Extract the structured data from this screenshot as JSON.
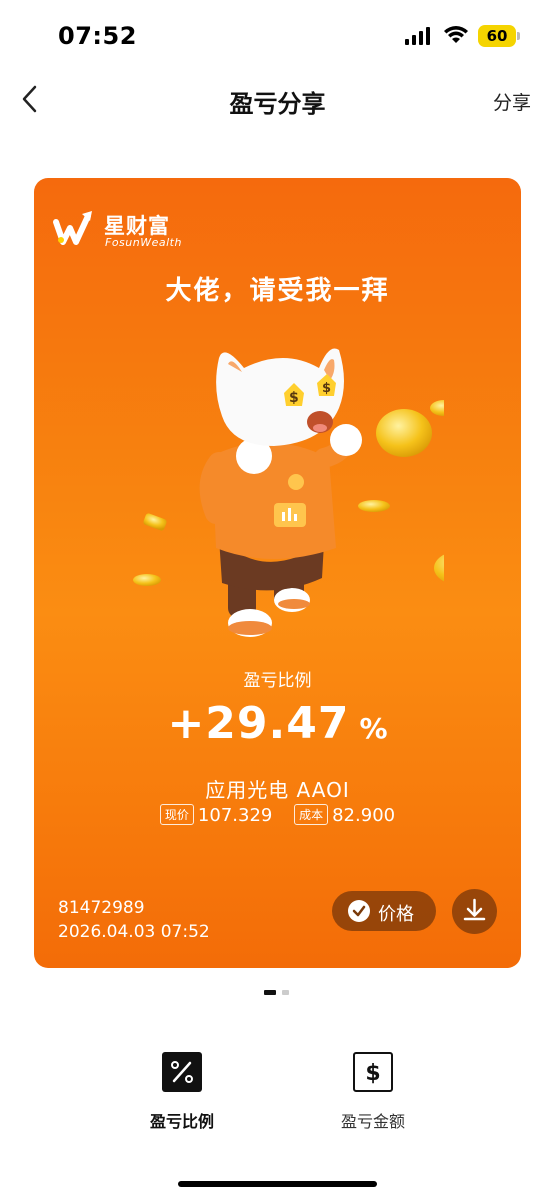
{
  "status_bar": {
    "time": "07:52",
    "battery": "60"
  },
  "nav": {
    "title": "盈亏分享",
    "share_label": "分享"
  },
  "card": {
    "logo_cn": "星财富",
    "logo_en": "FosunWealth",
    "slogan": "大佬，请受我一拜",
    "ratio_label": "盈亏比例",
    "ratio_value": "+29.47",
    "ratio_unit": "%",
    "stock_name": "应用光电 AAOI",
    "current_price_tag": "现价",
    "current_price": "107.329",
    "cost_tag": "成本",
    "cost": "82.900",
    "user_id": "81472989",
    "datetime": "2026.04.03 07:52",
    "price_button_label": "价格"
  },
  "pager": {
    "pages": 2,
    "active": 1
  },
  "options": [
    {
      "label": "盈亏比例",
      "icon": "percent-icon",
      "selected": true
    },
    {
      "label": "盈亏金额",
      "icon": "dollar-icon",
      "selected": false
    }
  ],
  "colors": {
    "card_orange": "#f7810f",
    "button_brown": "#78370a"
  }
}
